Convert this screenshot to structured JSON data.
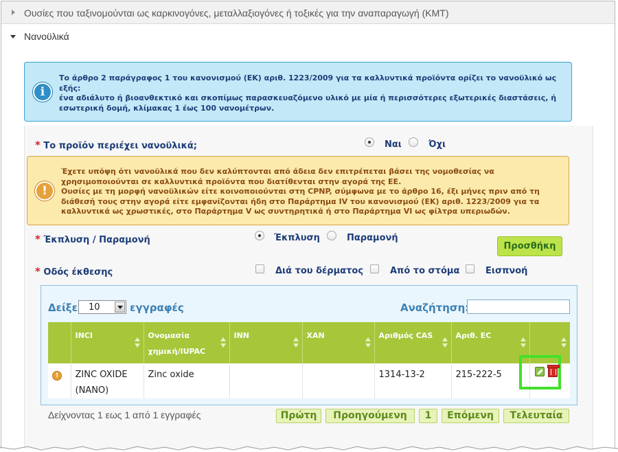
{
  "accordion": {
    "collapsed_section": "Ουσίες που ταξινομούνται ως καρκινογόνες, μεταλλαξιογόνες ή τοξικές για την αναπαραγωγή (ΚΜΤ)",
    "expanded_section": "Νανοϋλικά"
  },
  "info_box": {
    "icon": "info-icon",
    "text": "Το άρθρο 2 παράγραφος 1 του κανονισμού (ΕΚ) αριθ. 1223/2009 για τα καλλυντικά προϊόντα ορίζει το νανοϋλικό ως εξής:\nένα αδιάλυτο ή βιοανθεκτικό και σκοπίμως παρασκευαζόμενο υλικό με μία ή περισσότερες εξωτερικές διαστάσεις, ή εσωτερική δομή, κλίμακας 1 έως 100 νανομέτρων."
  },
  "form": {
    "required_mark": "*",
    "contains_nano": {
      "label": "Το προϊόν περιέχει νανοϋλικά;",
      "options": [
        "Ναι",
        "Όχι"
      ],
      "selected": "Ναι"
    },
    "warning": {
      "icon": "warning-icon",
      "text": "Έχετε υπόψη ότι νανοϋλικά που δεν καλύπτονται από άδεια δεν επιτρέπεται βάσει της νομοθεσίας να χρησιμοποιούνται σε καλλυντικά προϊόντα που διατίθενται στην αγορά της ΕΕ.\nΟυσίες με τη μορφή νανοϋλικών είτε κοινοποιούνται στη CPNP, σύμφωνα με το άρθρο 16, έξι μήνες πριν από τη διάθεσή τους στην αγορά είτε εμφανίζονται ήδη στο Παράρτημα IV του κανονισμού (ΕΚ) αριθ. 1223/2009 για τα καλλυντικά ως χρωστικές, στο Παράρτημα V ως συντηρητικά ή στο Παράρτημα VI ως φίλτρα υπεριωδών."
    },
    "rinse_leave": {
      "label": "Έκπλυση / Παραμονή",
      "options": [
        "Έκπλυση",
        "Παραμονή"
      ],
      "selected": "Έκπλυση"
    },
    "add_button": "Προσθήκη",
    "exposure": {
      "label": "Οδός έκθεσης",
      "options": [
        "Διά του δέρματος",
        "Από το στόμα",
        "Εισπνοή"
      ]
    }
  },
  "table": {
    "show_label": "Δείξε",
    "page_size": "10",
    "records_label": "εγγραφές",
    "search_label": "Αναζήτηση:",
    "search_value": "",
    "columns": [
      "INCI",
      "Ονομασία χημική/IUPAC",
      "INN",
      "XAN",
      "Αριθμός CAS",
      "Αριθ. EC",
      ""
    ],
    "rows": [
      {
        "inci": "ZINC OXIDE (NANO)",
        "chem_name": "Zinc oxide",
        "inn": "",
        "xan": "",
        "cas": "1314-13-2",
        "ec": "215-222-5"
      }
    ],
    "footer_info": "Δείχνοντας 1 εως 1 από 1 εγγραφές",
    "pagination": {
      "first": "Πρώτη",
      "previous": "Προηγούμενη",
      "page": "1",
      "next": "Επόμενη",
      "last": "Τελευταία"
    }
  },
  "colors": {
    "info_bg": "#c3e8f7",
    "warning_bg": "#fbeaac",
    "header_green": "#a7c63a",
    "highlight": "#44e02a"
  }
}
